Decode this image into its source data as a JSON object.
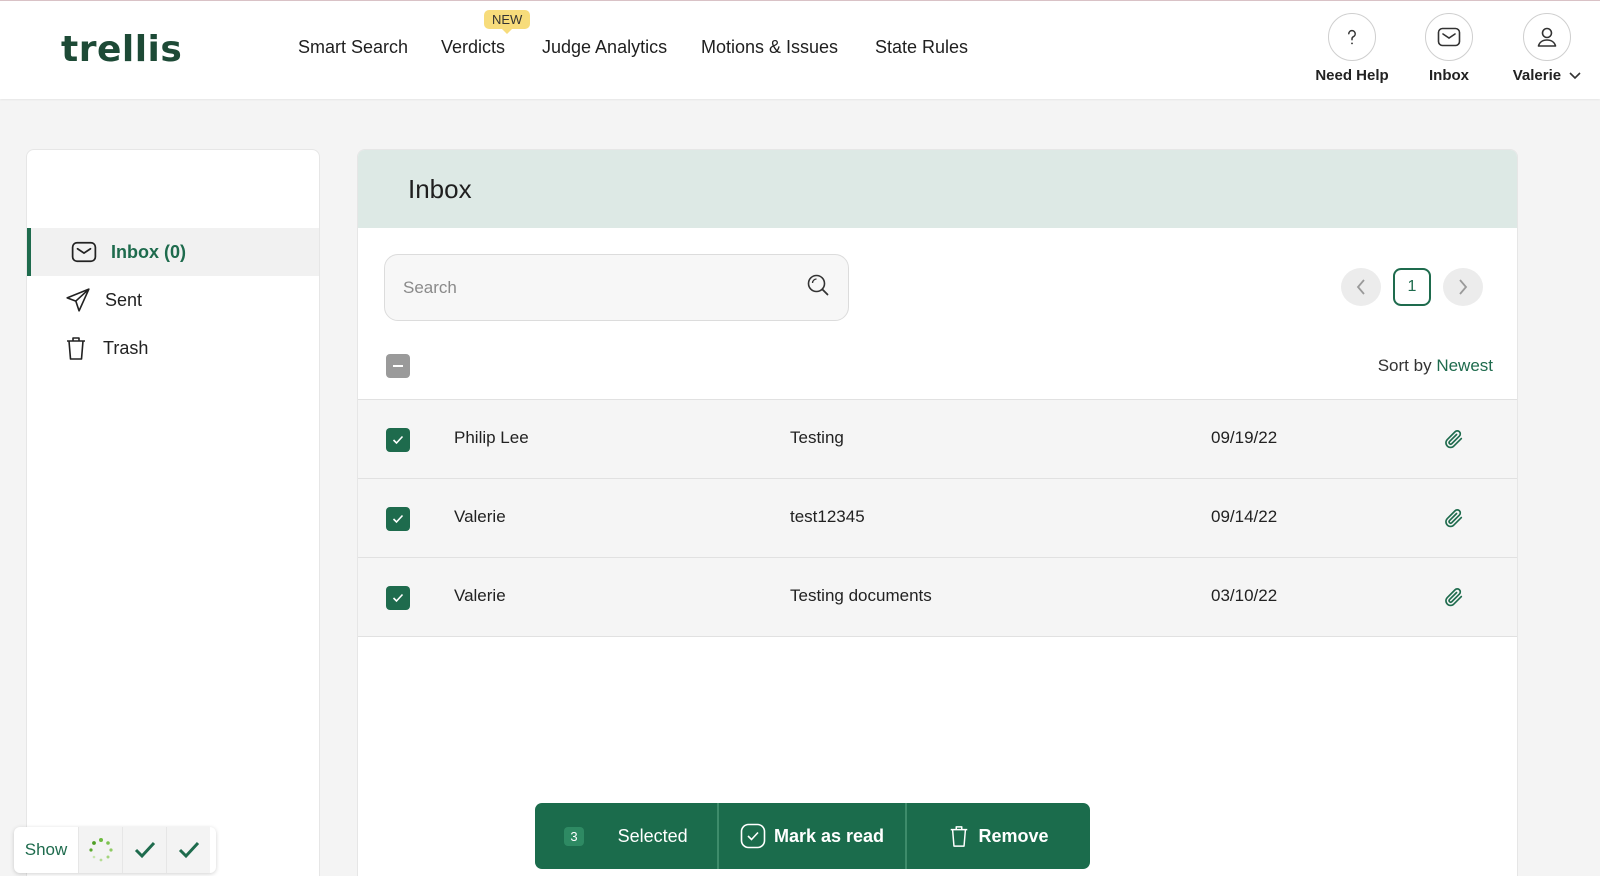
{
  "brand": {
    "logo_text": "trellis",
    "accent": "#1e6b4d"
  },
  "nav": {
    "items": [
      "Smart Search",
      "Verdicts",
      "Judge Analytics",
      "Motions & Issues",
      "State Rules"
    ],
    "new_badge": "NEW"
  },
  "top_actions": {
    "help": {
      "label": "Need Help",
      "icon": "question-icon"
    },
    "inbox": {
      "label": "Inbox",
      "icon": "mail-icon"
    },
    "user": {
      "label": "Valerie",
      "icon": "user-icon"
    }
  },
  "sidebar": {
    "items": [
      {
        "label": "Inbox (0)",
        "icon": "mail-icon",
        "active": true
      },
      {
        "label": "Sent",
        "icon": "send-icon",
        "active": false
      },
      {
        "label": "Trash",
        "icon": "trash-icon",
        "active": false
      }
    ]
  },
  "main": {
    "title": "Inbox",
    "search": {
      "placeholder": "Search",
      "value": ""
    },
    "pager": {
      "current_page": "1"
    },
    "sort": {
      "label": "Sort by",
      "value": "Newest"
    },
    "messages": [
      {
        "sender": "Philip Lee",
        "subject": "Testing",
        "date": "09/19/22",
        "checked": true,
        "attachment": true
      },
      {
        "sender": "Valerie",
        "subject": "test12345",
        "date": "09/14/22",
        "checked": true,
        "attachment": true
      },
      {
        "sender": "Valerie",
        "subject": "Testing documents",
        "date": "03/10/22",
        "checked": true,
        "attachment": true
      }
    ]
  },
  "action_bar": {
    "selected_count": "3",
    "selected_label": "Selected",
    "mark_read_label": "Mark as read",
    "remove_label": "Remove"
  },
  "mini_widget": {
    "show_label": "Show"
  }
}
